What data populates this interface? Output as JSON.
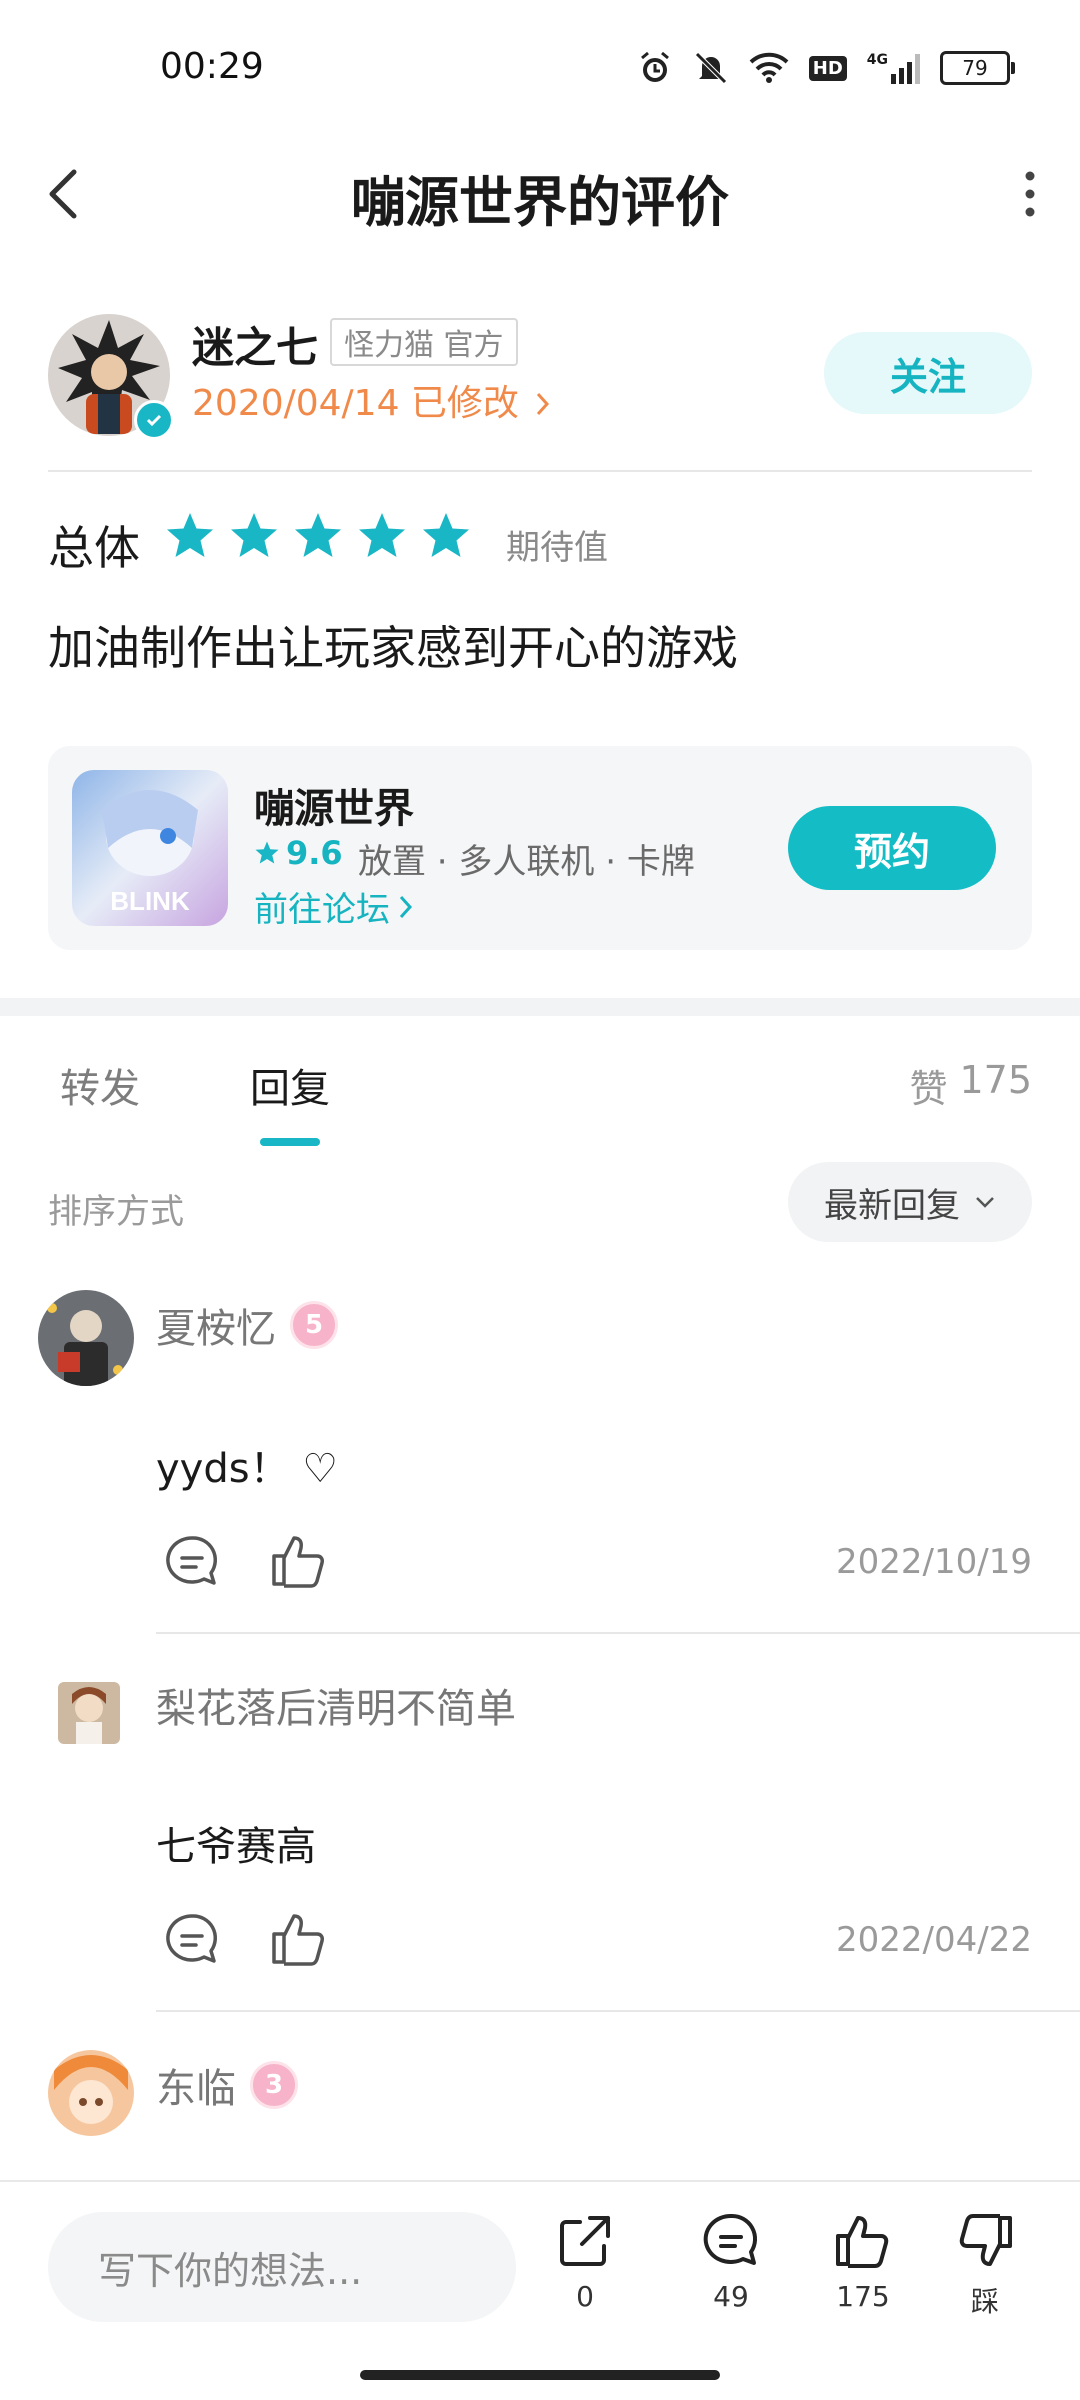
{
  "status_bar": {
    "time": "00:29",
    "hd_label": "HD",
    "network_label": "4G",
    "battery": "79"
  },
  "header": {
    "title": "嘣源世界的评价"
  },
  "author": {
    "name": "迷之七",
    "tag": "怪力猫 官方",
    "date": "2020/04/14 已修改",
    "follow_label": "关注"
  },
  "rating": {
    "label": "总体",
    "stars": 5,
    "expect_label": "期待值",
    "star_color": "#19b7c6"
  },
  "review": {
    "text": "加油制作出让玩家感到开心的游戏"
  },
  "game": {
    "name": "嘣源世界",
    "score": "9.6",
    "tags": "放置 · 多人联机 · 卡牌",
    "forum_link": "前往论坛",
    "reserve_label": "预约",
    "icon_text": "BLINK"
  },
  "tabs": {
    "forward": "转发",
    "reply": "回复",
    "likes_label": "赞",
    "likes_count": "175"
  },
  "sort": {
    "label": "排序方式",
    "selected": "最新回复"
  },
  "comments": [
    {
      "name": "夏桉忆",
      "level": "5",
      "text": "yyds！ ♡",
      "date": "2022/10/19"
    },
    {
      "name": "梨花落后清明不简单",
      "level": "",
      "text": "七爷赛高",
      "date": "2022/04/22"
    },
    {
      "name": "东临",
      "level": "3",
      "text": "",
      "date": ""
    }
  ],
  "bottom_bar": {
    "input_placeholder": "写下你的想法...",
    "share_count": "0",
    "comment_count": "49",
    "like_count": "175",
    "dislike_label": "踩"
  },
  "colors": {
    "accent": "#19b7c6",
    "date_orange": "#f08a4b"
  }
}
